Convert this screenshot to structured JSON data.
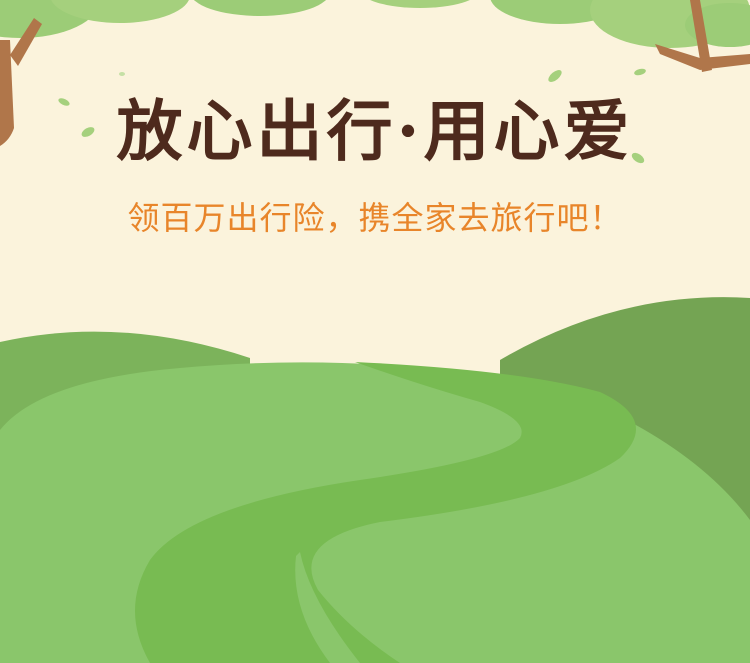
{
  "banner": {
    "title": "放心出行·用心爱",
    "subtitle": "领百万出行险，携全家去旅行吧！"
  },
  "colors": {
    "sky": "#fbf3dc",
    "title": "#4e2a1d",
    "subtitle": "#e8852a",
    "hill_dark": "#74a453",
    "hill_mid": "#8ac66b",
    "path": "#78bb52",
    "leaf": "#a5d07d",
    "trunk": "#b0764a"
  }
}
